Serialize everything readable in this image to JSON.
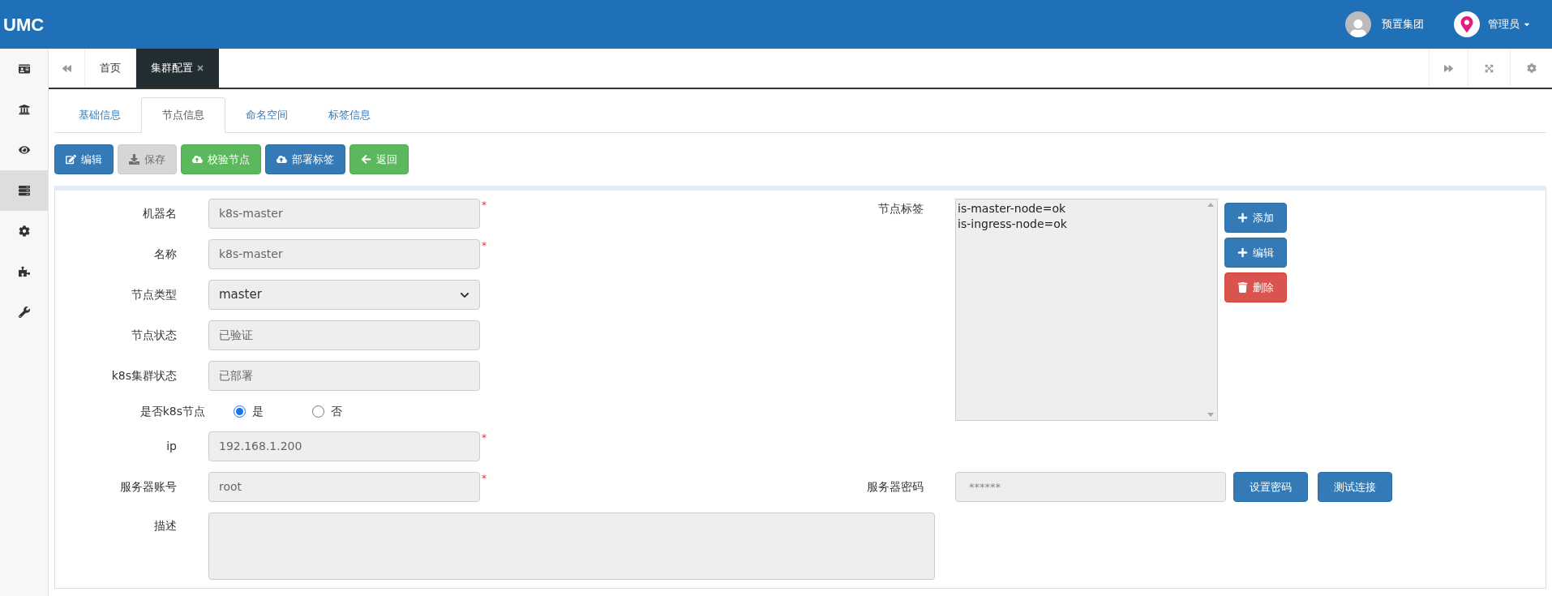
{
  "header": {
    "brand": "UMC",
    "org": "预置集团",
    "user": "管理员"
  },
  "sidebar": {
    "items": [
      {
        "selected": false
      },
      {
        "selected": false
      },
      {
        "selected": false
      },
      {
        "selected": true
      },
      {
        "selected": false
      },
      {
        "selected": false
      },
      {
        "selected": false
      }
    ]
  },
  "page_tabs": [
    {
      "label": "首页",
      "selected": false,
      "closable": false
    },
    {
      "label": "集群配置",
      "selected": true,
      "closable": true
    }
  ],
  "sub_tabs": [
    {
      "label": "基础信息",
      "selected": false
    },
    {
      "label": "节点信息",
      "selected": true
    },
    {
      "label": "命名空间",
      "selected": false
    },
    {
      "label": "标签信息",
      "selected": false
    }
  ],
  "toolbar": [
    {
      "label": "编辑",
      "kind": "primary",
      "disabled": false
    },
    {
      "label": "保存",
      "disabled": true
    },
    {
      "label": "校验节点",
      "kind": "success",
      "disabled": false
    },
    {
      "label": "部署标签",
      "kind": "primary",
      "disabled": false
    },
    {
      "label": "返回",
      "kind": "success",
      "disabled": false
    }
  ],
  "form": {
    "fields": [
      {
        "label": "机器名",
        "kind": "input",
        "value": "k8s-master",
        "required_mark": "*"
      },
      {
        "label": "名称",
        "kind": "input",
        "value": "k8s-master",
        "required_mark": "*"
      },
      {
        "label": "节点类型",
        "kind": "select",
        "value": "master"
      },
      {
        "label": "节点状态",
        "kind": "input",
        "value": "已验证"
      },
      {
        "label": "k8s集群状态",
        "kind": "input",
        "value": "已部署"
      },
      {
        "label": "是否k8s节点",
        "kind": "radio",
        "options": [
          {
            "label": "是",
            "selected": true
          },
          {
            "label": "否",
            "selected": false
          }
        ]
      },
      {
        "label": "ip",
        "kind": "input",
        "value": "192.168.1.200",
        "required_mark": "*"
      }
    ],
    "node_labels": {
      "label": "节点标签",
      "items": [
        "is-master-node=ok",
        "is-ingress-node=ok"
      ],
      "buttons": [
        {
          "label": "添加",
          "kind": "primary"
        },
        {
          "label": "编辑",
          "kind": "primary"
        },
        {
          "label": "删除",
          "kind": "danger"
        }
      ]
    },
    "account": {
      "label": "服务器账号",
      "value": "root",
      "required_mark": "*"
    },
    "password": {
      "label": "服务器密码",
      "placeholder": "******",
      "buttons": [
        {
          "label": "设置密码"
        },
        {
          "label": "测试连接"
        }
      ]
    },
    "description": {
      "label": "描述"
    }
  }
}
